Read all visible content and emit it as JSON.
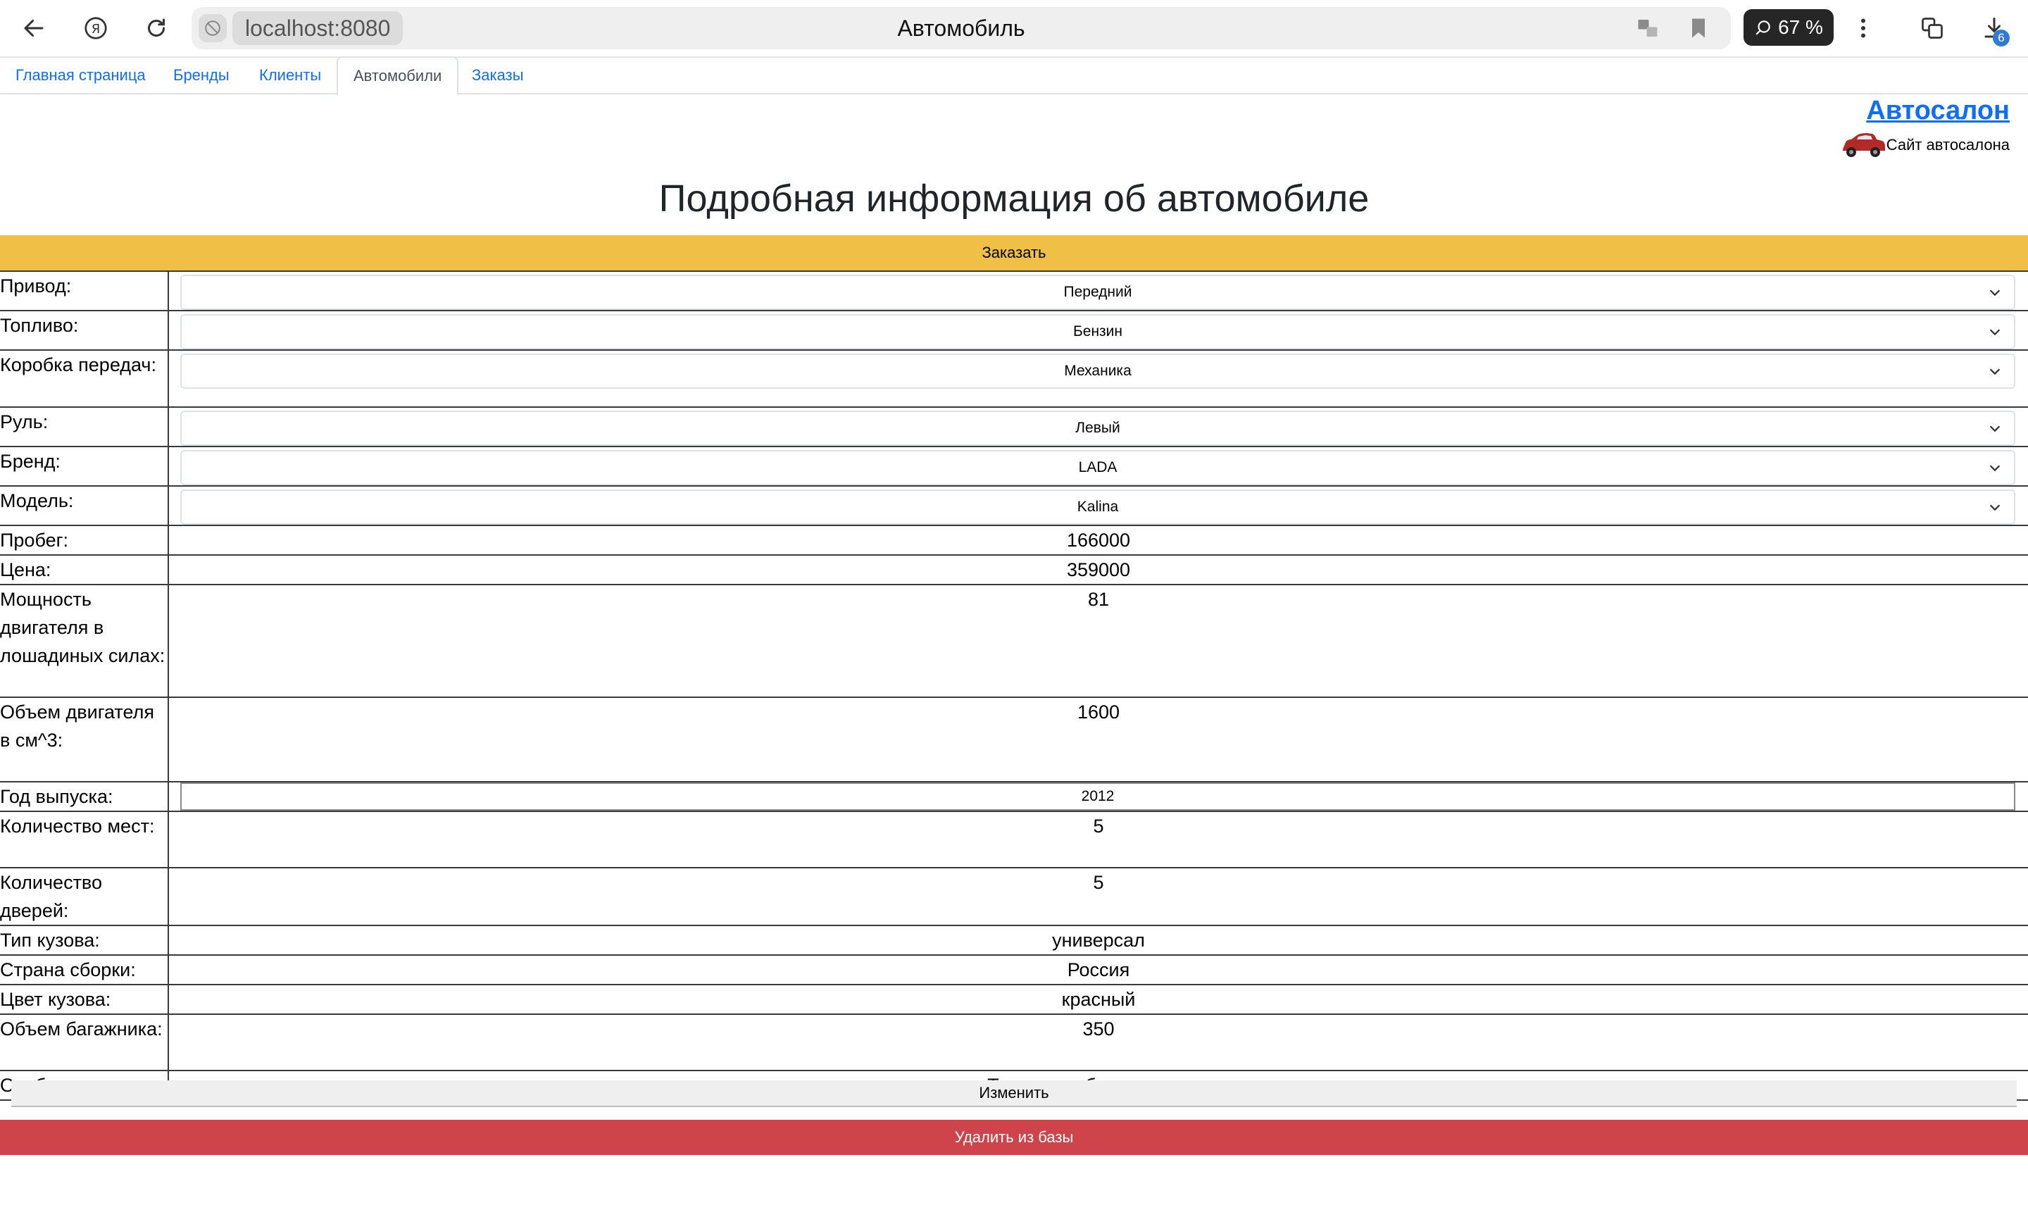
{
  "browser": {
    "url": "localhost:8080",
    "tab_title": "Автомобиль",
    "zoom": "67 %",
    "downloads_badge": "6"
  },
  "nav": {
    "tabs": [
      {
        "label": "Главная страница"
      },
      {
        "label": "Бренды"
      },
      {
        "label": "Клиенты"
      },
      {
        "label": "Автомобили",
        "active": true
      },
      {
        "label": "Заказы"
      }
    ]
  },
  "brand": {
    "title": "Автосалон",
    "subtitle": "Сайт автосалона"
  },
  "page": {
    "title": "Подробная информация об автомобиле",
    "order_label": "Заказать",
    "edit_label": "Изменить",
    "delete_label": "Удалить из базы"
  },
  "car": {
    "drive": {
      "label": "Привод:",
      "value": "Передний"
    },
    "fuel": {
      "label": "Топливо:",
      "value": "Бензин"
    },
    "gearbox": {
      "label": "Коробка передач:",
      "value": "Механика"
    },
    "steering": {
      "label": "Руль:",
      "value": "Левый"
    },
    "brand": {
      "label": "Бренд:",
      "value": "LADA"
    },
    "model": {
      "label": "Модель:",
      "value": "Kalina"
    },
    "mileage": {
      "label": "Пробег:",
      "value": "166000"
    },
    "price": {
      "label": "Цена:",
      "value": "359000"
    },
    "power": {
      "label": "Мощность двигателя в лошадиных силах:",
      "value": "81"
    },
    "engine_volume": {
      "label": "Объем двигателя в см^3:",
      "value": "1600"
    },
    "year": {
      "label": "Год выпуска:",
      "value": "2012"
    },
    "seats": {
      "label": "Количество мест:",
      "value": "5"
    },
    "doors": {
      "label": "Количество дверей:",
      "value": "5"
    },
    "body_type": {
      "label": "Тип кузова:",
      "value": "универсал"
    },
    "country": {
      "label": "Страна сборки:",
      "value": "Россия"
    },
    "color": {
      "label": "Цвет кузова:",
      "value": "красный"
    },
    "trunk": {
      "label": "Объем багажника:",
      "value": "350"
    },
    "features": {
      "label": "Особенности:",
      "value": "Тканевая обивка салона;"
    }
  }
}
